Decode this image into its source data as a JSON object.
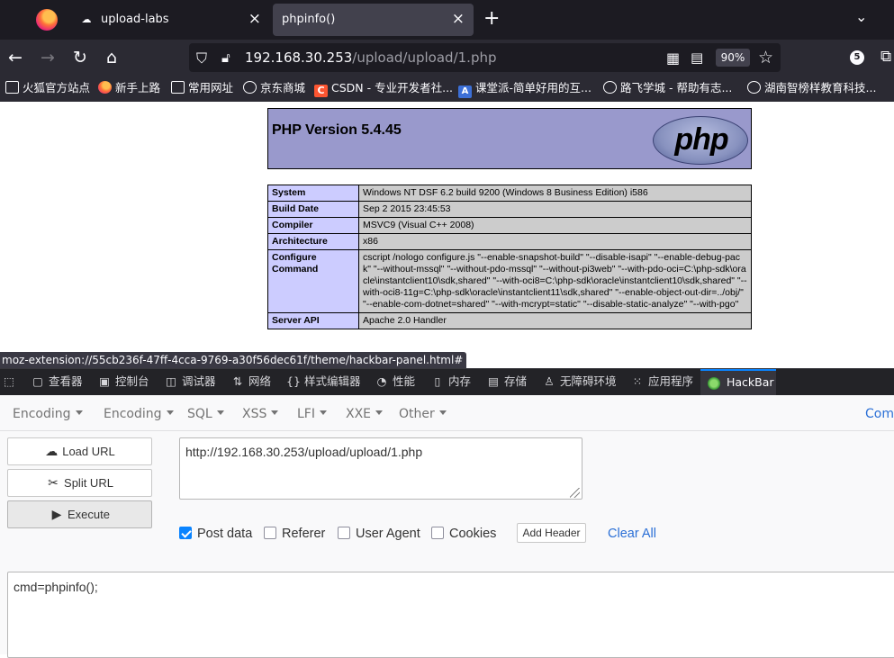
{
  "browser": {
    "tabs": [
      {
        "label": "upload-labs",
        "active": false
      },
      {
        "label": "phpinfo()",
        "active": true
      }
    ],
    "address": {
      "host": "192.168.30.253",
      "path": "/upload/upload/1.php",
      "zoom": "90%"
    },
    "notification_count": "5",
    "bookmarks": [
      {
        "label": "火狐官方站点",
        "icon": "folder-icon"
      },
      {
        "label": "新手上路",
        "icon": "firefox-icon"
      },
      {
        "label": "常用网址",
        "icon": "folder-icon"
      },
      {
        "label": "京东商城",
        "icon": "globe-icon"
      },
      {
        "label": "CSDN - 专业开发者社...",
        "icon": "csdn-icon"
      },
      {
        "label": "课堂派-简单好用的互...",
        "icon": "ketangpai-icon"
      },
      {
        "label": "路飞学城 - 帮助有志...",
        "icon": "globe-icon"
      },
      {
        "label": "湖南智榜样教育科技...",
        "icon": "globe-icon"
      }
    ],
    "status_url": "moz-extension://55cb236f-47ff-4cca-9769-a30f56dec61f/theme/hackbar-panel.html#"
  },
  "phpinfo": {
    "title": "PHP Version 5.4.45",
    "logo_text": "php",
    "rows": [
      {
        "key": "System",
        "value": "Windows NT DSF 6.2 build 9200 (Windows 8 Business Edition) i586"
      },
      {
        "key": "Build Date",
        "value": "Sep 2 2015 23:45:53"
      },
      {
        "key": "Compiler",
        "value": "MSVC9 (Visual C++ 2008)"
      },
      {
        "key": "Architecture",
        "value": "x86"
      },
      {
        "key": "Configure Command",
        "value": "cscript /nologo configure.js \"--enable-snapshot-build\" \"--disable-isapi\" \"--enable-debug-pack\" \"--without-mssql\" \"--without-pdo-mssql\" \"--without-pi3web\" \"--with-pdo-oci=C:\\php-sdk\\oracle\\instantclient10\\sdk,shared\" \"--with-oci8=C:\\php-sdk\\oracle\\instantclient10\\sdk,shared\" \"--with-oci8-11g=C:\\php-sdk\\oracle\\instantclient11\\sdk,shared\" \"--enable-object-out-dir=../obj/\" \"--enable-com-dotnet=shared\" \"--with-mcrypt=static\" \"--disable-static-analyze\" \"--with-pgo\""
      },
      {
        "key": "Server API",
        "value": "Apache 2.0 Handler"
      }
    ]
  },
  "devtools": {
    "tabs": [
      {
        "label": "查看器",
        "icon": "inspector-icon"
      },
      {
        "label": "控制台",
        "icon": "console-icon"
      },
      {
        "label": "调试器",
        "icon": "debugger-icon"
      },
      {
        "label": "网络",
        "icon": "network-icon"
      },
      {
        "label": "样式编辑器",
        "icon": "style-editor-icon"
      },
      {
        "label": "性能",
        "icon": "performance-icon"
      },
      {
        "label": "内存",
        "icon": "memory-icon"
      },
      {
        "label": "存储",
        "icon": "storage-icon"
      },
      {
        "label": "无障碍环境",
        "icon": "accessibility-icon"
      },
      {
        "label": "应用程序",
        "icon": "application-icon"
      }
    ],
    "active_tab": "HackBar"
  },
  "hackbar": {
    "menus": [
      "Encoding",
      "Encoding",
      "SQL",
      "XSS",
      "LFI",
      "XXE",
      "Other"
    ],
    "commit_label": "Comm",
    "load_url": "Load URL",
    "split_url": "Split URL",
    "execute": "Execute",
    "url_value": "http://192.168.30.253/upload/upload/1.php",
    "options": [
      {
        "label": "Post data",
        "checked": true
      },
      {
        "label": "Referer",
        "checked": false
      },
      {
        "label": "User Agent",
        "checked": false
      },
      {
        "label": "Cookies",
        "checked": false
      }
    ],
    "add_header": "Add Header",
    "clear_all": "Clear All",
    "post_body": "cmd=phpinfo();"
  },
  "colors": {
    "php_header": "#9999cc",
    "php_key_cell": "#ccccff",
    "php_value_cell": "#cccccc",
    "accent_blue": "#0a84ff",
    "chrome_dark": "#1c1b22"
  }
}
